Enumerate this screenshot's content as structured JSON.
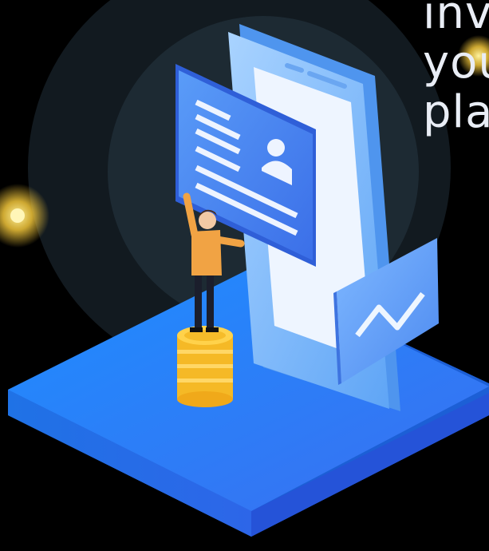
{
  "headline": {
    "line1": "inv",
    "line2": "you",
    "line3": "pla"
  },
  "illustration": {
    "icons": [
      "phone-icon",
      "profile-card-icon",
      "chart-card-icon",
      "coin-stack-icon",
      "person-icon",
      "glow-dot-icon"
    ],
    "colors": {
      "background": "#000000",
      "halo": "#1d2a33",
      "platform": "#2f7cf0",
      "phone": "#8fc3ff",
      "card": "#4d8af5",
      "coins": "#f7c131",
      "person_shirt": "#f1a344",
      "glow": "#f6d44a"
    }
  }
}
